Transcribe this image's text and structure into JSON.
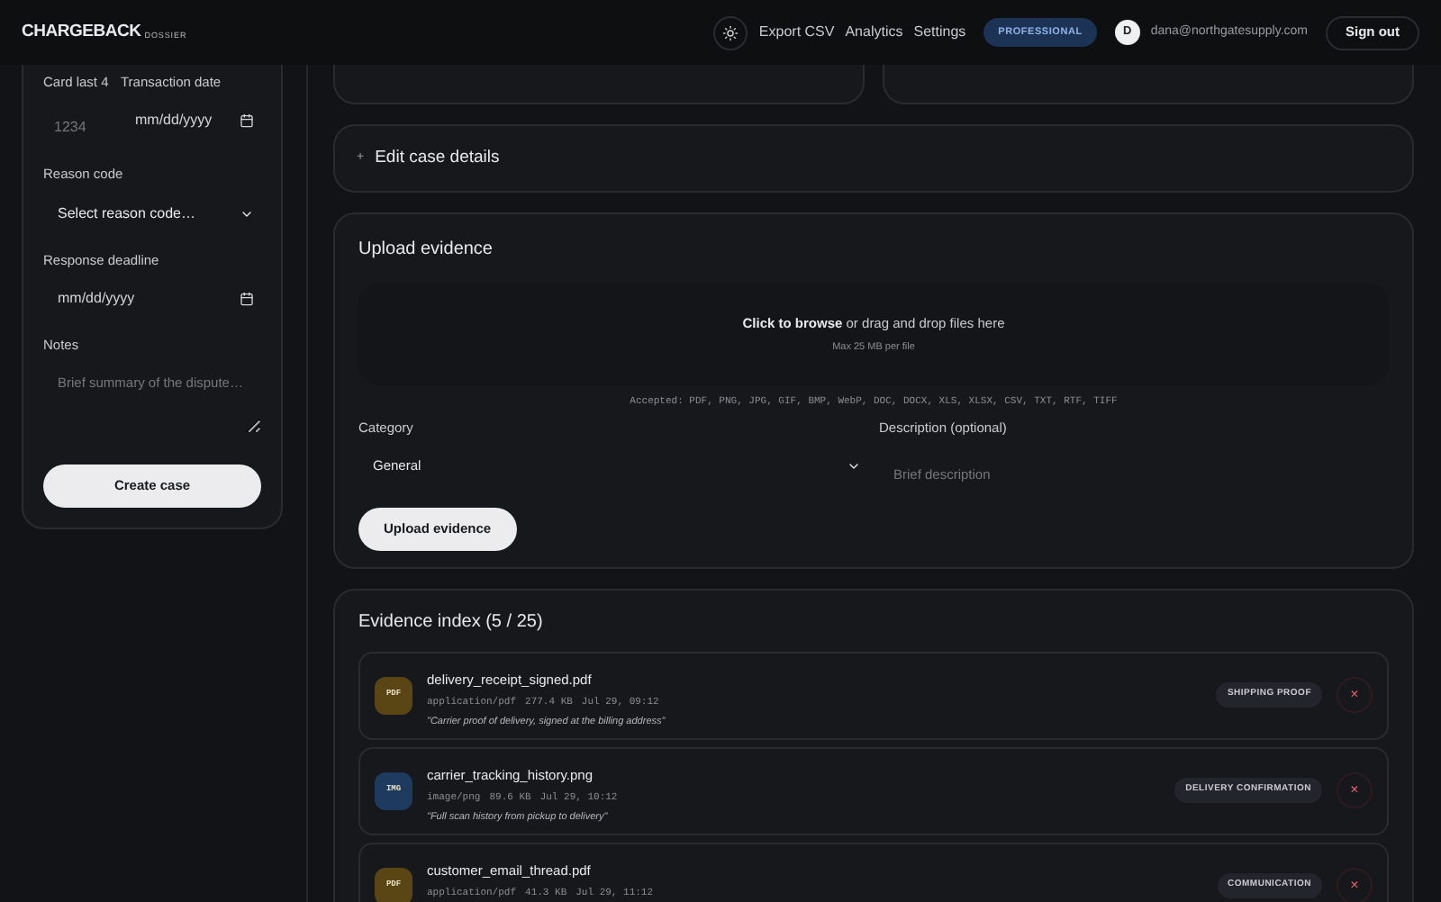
{
  "header": {
    "logo": "CHARGEBACK",
    "logo_suffix": "DOSSIER",
    "nav": [
      "Export CSV",
      "Analytics",
      "Settings"
    ],
    "plan_badge": "PROFESSIONAL",
    "avatar": "D",
    "email": "dana@northgatesupply.com",
    "sign_out": "Sign out"
  },
  "new_case_form": {
    "card_last4": {
      "label": "Card last 4",
      "placeholder": "1234"
    },
    "transaction_date": {
      "label": "Transaction date",
      "placeholder": "mm/dd/yyyy"
    },
    "reason_code": {
      "label": "Reason code",
      "value": "Select reason code…"
    },
    "response_deadline": {
      "label": "Response deadline",
      "placeholder": "mm/dd/yyyy"
    },
    "notes": {
      "label": "Notes",
      "placeholder": "Brief summary of the dispute…"
    },
    "submit": "Create case"
  },
  "edit_case": {
    "icon": "+",
    "label": "Edit case details"
  },
  "upload": {
    "title": "Upload evidence",
    "dropzone_action": "Click to browse",
    "dropzone_text": "or drag and drop files here",
    "dropzone_limit": "Max 25 MB per file",
    "accepted": "Accepted: PDF, PNG, JPG, GIF, BMP, WebP, DOC, DOCX, XLS, XLSX, CSV, TXT, RTF, TIFF",
    "category": {
      "label": "Category",
      "value": "General"
    },
    "description": {
      "label": "Description (optional)",
      "placeholder": "Brief description"
    },
    "submit": "Upload evidence"
  },
  "evidence_index": {
    "title": "Evidence index (5 / 25)",
    "items": [
      {
        "type": "PDF",
        "color": "#5a4514",
        "name": "delivery_receipt_signed.pdf",
        "mime": "application/pdf",
        "size": "277.4 KB",
        "time": "Jul 29, 09:12",
        "note": "\"Carrier proof of delivery, signed at the billing address\"",
        "tag": "SHIPPING PROOF",
        "delete": "×"
      },
      {
        "type": "IMG",
        "color": "#1e3a5f",
        "name": "carrier_tracking_history.png",
        "mime": "image/png",
        "size": "89.6 KB",
        "time": "Jul 29, 10:12",
        "note": "\"Full scan history from pickup to delivery\"",
        "tag": "DELIVERY CONFIRMATION",
        "delete": "×"
      },
      {
        "type": "PDF",
        "color": "#5a4514",
        "name": "customer_email_thread.pdf",
        "mime": "application/pdf",
        "size": "41.3 KB",
        "time": "Jul 29, 11:12",
        "tag": "COMMUNICATION",
        "delete": "×"
      }
    ]
  }
}
